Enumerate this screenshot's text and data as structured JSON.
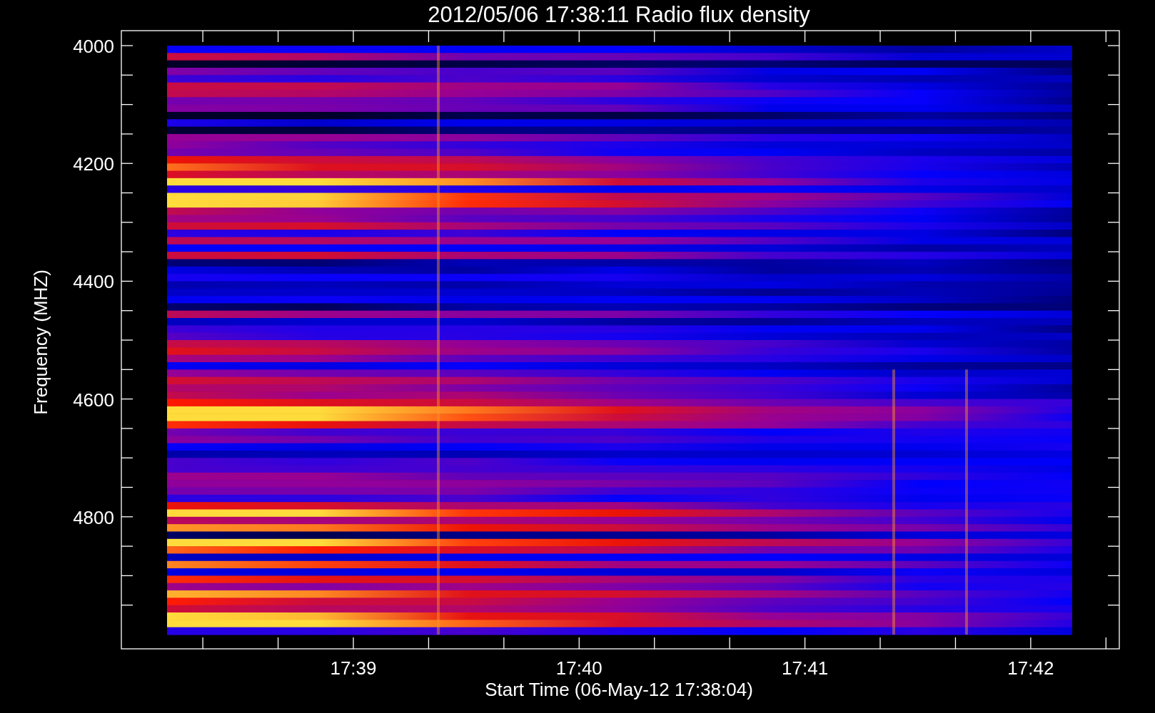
{
  "plot": {
    "title": "2012/05/06 17:38:11 Radio flux density",
    "x_axis": {
      "label": "Start Time (06-May-12 17:38:04)",
      "tick_labels": [
        "17:39",
        "17:40",
        "17:41",
        "17:42"
      ]
    },
    "y_axis": {
      "label": "Frequency (MHZ)",
      "tick_labels": [
        "4000",
        "4200",
        "4400",
        "4600",
        "4800"
      ]
    }
  }
}
